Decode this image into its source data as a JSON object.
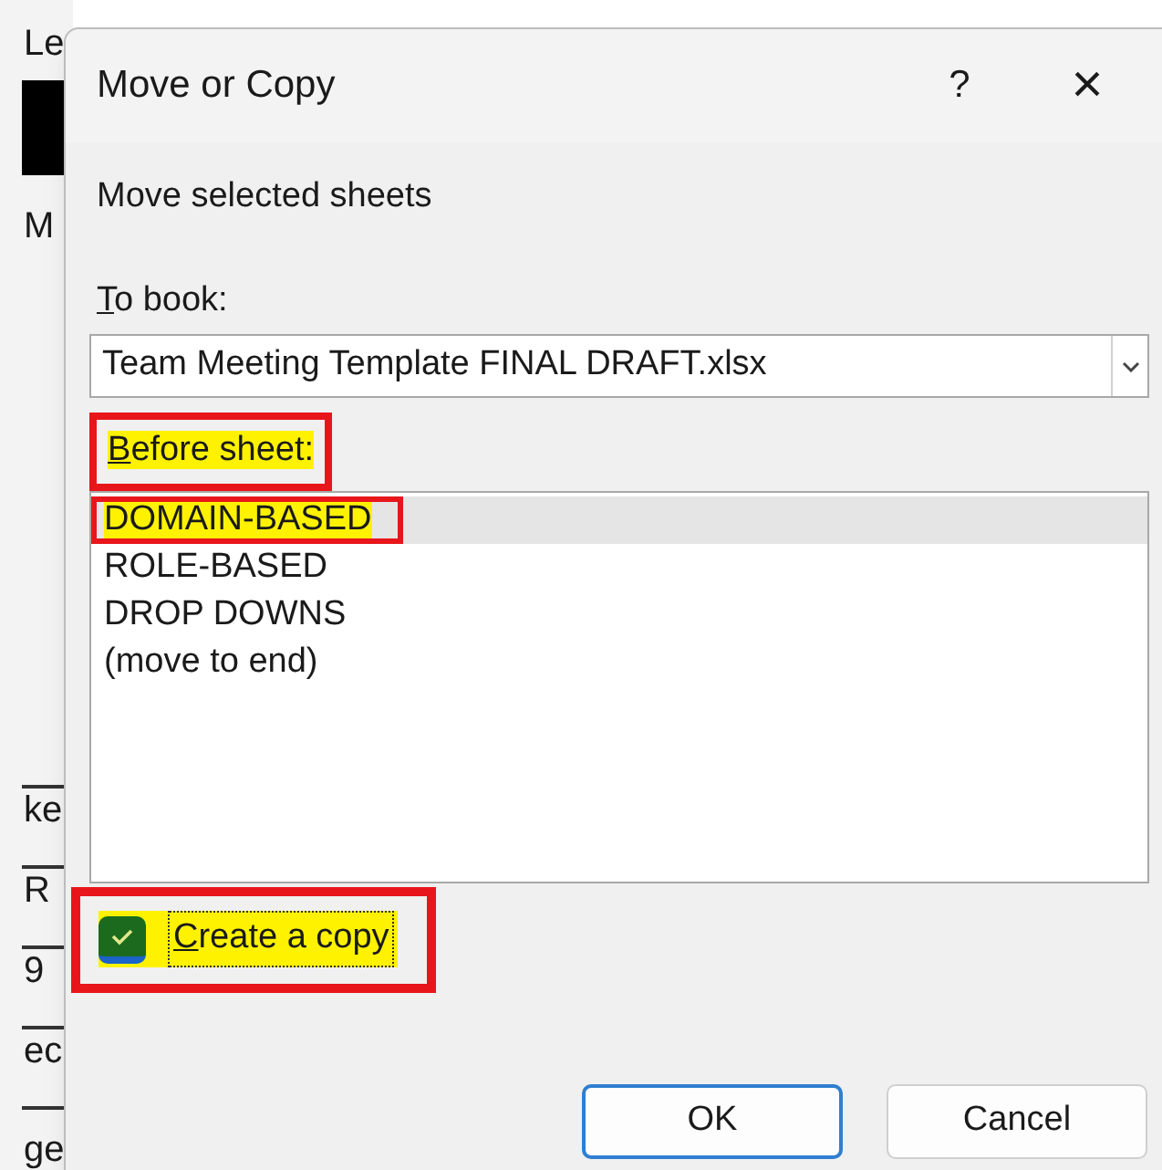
{
  "background_cells": [
    {
      "text": "Le"
    },
    {
      "text": "M"
    },
    {
      "text": "ke"
    },
    {
      "text": "R"
    },
    {
      "text": "9"
    },
    {
      "text": "ec"
    },
    {
      "text": "ge"
    }
  ],
  "dialog": {
    "title": "Move or Copy",
    "help": "?",
    "close": "×",
    "subtitle": "Move selected sheets",
    "to_book": {
      "label": "To book:",
      "value": "Team Meeting Template FINAL DRAFT.xlsx"
    },
    "before_sheet": {
      "label": "Before sheet:",
      "highlighted": true,
      "outlined": true,
      "items": [
        {
          "text": "DOMAIN-BASED",
          "selected": true,
          "highlighted": true,
          "outlined": true
        },
        {
          "text": "ROLE-BASED",
          "selected": false,
          "highlighted": false,
          "outlined": false
        },
        {
          "text": "DROP DOWNS",
          "selected": false,
          "highlighted": false,
          "outlined": false
        },
        {
          "text": "(move to end)",
          "selected": false,
          "highlighted": false,
          "outlined": false
        }
      ]
    },
    "create_copy": {
      "label": "Create a copy",
      "checked": true,
      "highlighted": true,
      "outlined": true
    },
    "buttons": [
      {
        "label": "OK",
        "default": true
      },
      {
        "label": "Cancel",
        "default": false
      }
    ]
  }
}
